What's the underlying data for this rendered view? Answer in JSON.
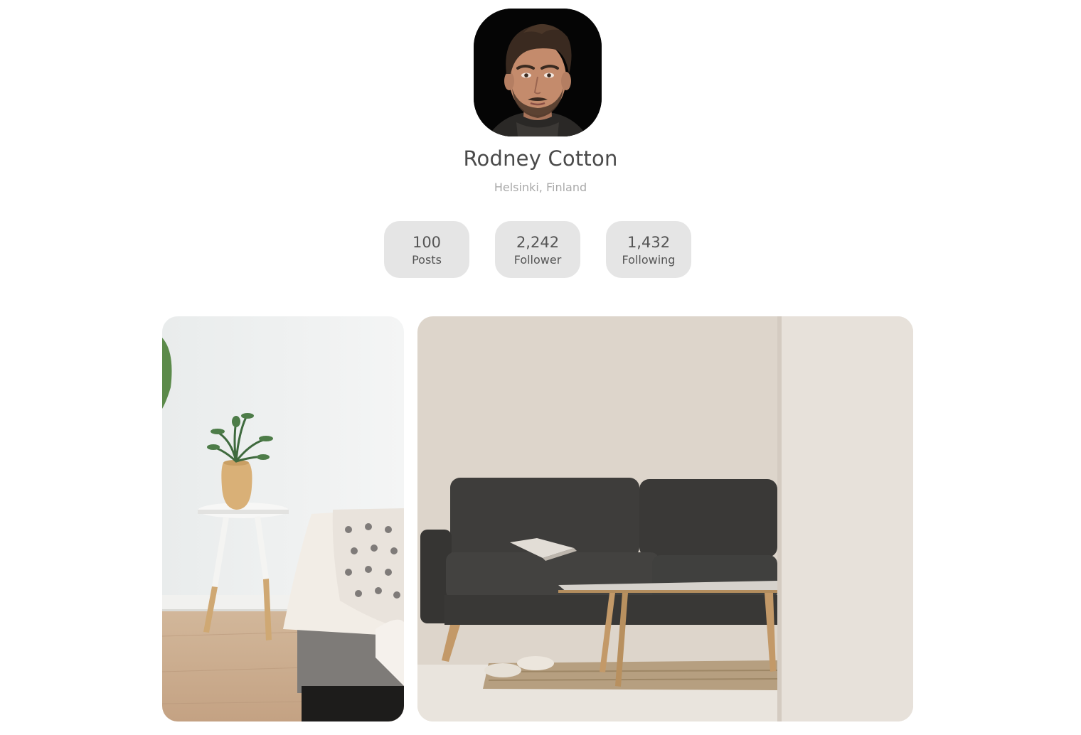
{
  "profile": {
    "name": "Rodney Cotton",
    "location": "Helsinki, Finland"
  },
  "stats": [
    {
      "value": "100",
      "label": "Posts"
    },
    {
      "value": "2,242",
      "label": "Follower"
    },
    {
      "value": "1,432",
      "label": "Following"
    }
  ],
  "gallery": {
    "photos": [
      {
        "subject": "bedroom-side-table-plant"
      },
      {
        "subject": "living-room-grey-sofa"
      }
    ]
  }
}
